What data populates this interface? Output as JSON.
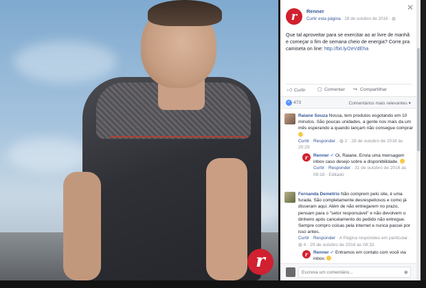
{
  "post": {
    "page_name": "Renner",
    "follow_label": "Curtir esta página",
    "date": "28 de outubro de 2016",
    "text": "Que tal aproveitar para se exercitar ao ar livre de manhã e começar o fim de semana cheio de energia? Corre pra camiseta on line:",
    "url": "http://bit.ly/2eVdEha",
    "logo_letter": "r"
  },
  "actions": {
    "like": "Curtir",
    "comment": "Comentar",
    "share": "Compartilhar"
  },
  "reactions": {
    "count": "473",
    "sort": "Comentários mais relevantes"
  },
  "comments": [
    {
      "author": "Raiane Souza",
      "text": "Nossa, tem produtos esgotando em 10 minutos. São poucas unidades, a gente nos mais da um mês esperando a quando lançam não consegue comprar",
      "like": "Curtir",
      "reply": "Responder",
      "reactions": "2",
      "date": "28 de outubro de 2016 às 20:29",
      "replies": [
        {
          "author": "Renner",
          "text": "Oi, Raiane. Envia uma mensagem inbox caso desejo sobre a disponibilidade.",
          "like": "Curtir",
          "reply": "Responder",
          "date": "31 de outubro de 2016 às 09:18",
          "edited": "Editado"
        }
      ]
    },
    {
      "author": "Fernanda Demétrio",
      "text": "Não comprem pelo site, é uma furada. São completamente desrespeitosos e como já disseram aqui. Além de não entregarem no prazo, pensam para o \"setor responsável\" e não devolvem o dinheiro após cancelamento do pedido não entregue. Sempre compro coisas pela internet e nunca passei por isso antes.",
      "like": "Curtir",
      "reply": "Responder",
      "page_replied": "A Página respondeu em particular",
      "reactions": "4",
      "date": "29 de outubro de 2016 às 08:33",
      "replies": [
        {
          "author": "Renner",
          "text": "Entramos em contato com você via inbox."
        }
      ]
    }
  ],
  "composer": {
    "placeholder": "Escreva um comentário..."
  }
}
